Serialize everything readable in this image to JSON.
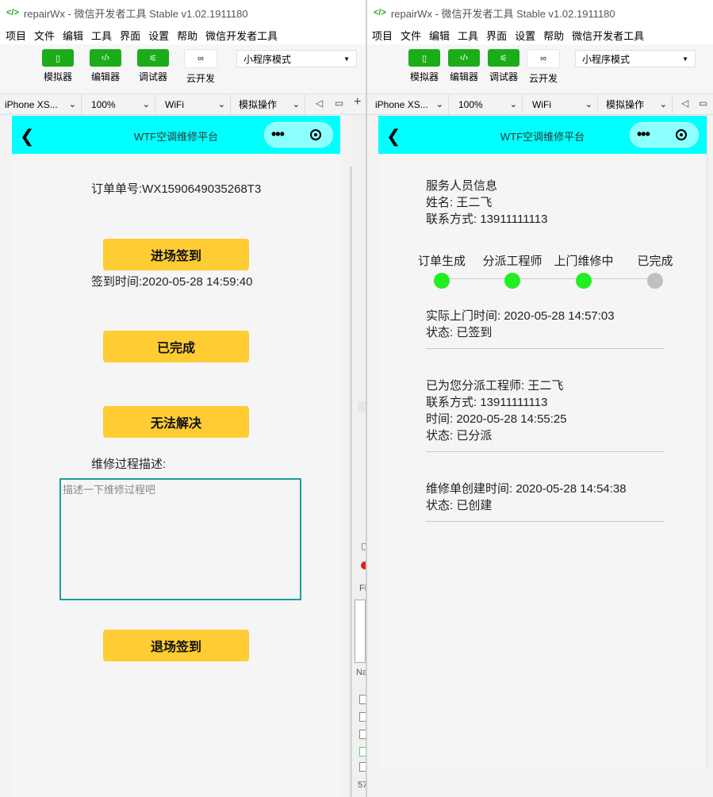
{
  "left": {
    "window_title": "repairWx - 微信开发者工具 Stable v1.02.1911180",
    "menu": [
      "项目",
      "文件",
      "编辑",
      "工具",
      "界面",
      "设置",
      "帮助",
      "微信开发者工具"
    ],
    "toolbar": [
      {
        "label": "模拟器",
        "icon": "phone-icon"
      },
      {
        "label": "编辑器",
        "icon": "code-icon"
      },
      {
        "label": "调试器",
        "icon": "debug-icon"
      },
      {
        "label": "云开发",
        "icon": "cloud-link-icon"
      }
    ],
    "mode": "小程序模式",
    "device_bar": {
      "device": "iPhone XS...",
      "zoom": "100%",
      "network": "WiFi",
      "simulate": "模拟操作"
    },
    "page": {
      "nav_title": "WTF空调维修平台",
      "order_label": "订单单号:",
      "order_no": "WX1590649035268T3",
      "checkin_button": "进场签到",
      "checkin_time_label": "签到时间:",
      "checkin_time": "2020-05-28 14:59:40",
      "done_button": "已完成",
      "unsolved_button": "无法解决",
      "desc_label": "维修过程描述:",
      "desc_placeholder": "描述一下维修过程吧",
      "checkout_button": "退场签到"
    },
    "side_panel": {
      "network_filter_label": "Fi",
      "name_col": "Na",
      "footer": "57"
    }
  },
  "right": {
    "window_title": "repairWx - 微信开发者工具 Stable v1.02.1911180",
    "menu": [
      "项目",
      "文件",
      "编辑",
      "工具",
      "界面",
      "设置",
      "帮助",
      "微信开发者工具"
    ],
    "toolbar": [
      {
        "label": "模拟器",
        "icon": "phone-icon"
      },
      {
        "label": "编辑器",
        "icon": "code-icon"
      },
      {
        "label": "调试器",
        "icon": "debug-icon"
      },
      {
        "label": "云开发",
        "icon": "cloud-link-icon"
      }
    ],
    "mode": "小程序模式",
    "device_bar": {
      "device": "iPhone XS...",
      "zoom": "100%",
      "network": "WiFi",
      "simulate": "模拟操作"
    },
    "page": {
      "nav_title": "WTF空调维修平台",
      "staff_title": "服务人员信息",
      "staff_name_line": "姓名: 王二飞",
      "staff_contact_line": "联系方式: 13911111113",
      "steps": [
        {
          "label": "订单生成",
          "color": "#22ee22"
        },
        {
          "label": "分派工程师",
          "color": "#22ee22"
        },
        {
          "label": "上门维修中",
          "color": "#22ee22"
        },
        {
          "label": "已完成",
          "color": "#c0c0c0"
        }
      ],
      "timeline": [
        {
          "line1": "实际上门时间: 2020-05-28 14:57:03",
          "line2": "状态: 已签到"
        },
        {
          "line1": "已为您分派工程师: 王二飞",
          "line2": "联系方式: 13911111113",
          "line3": "时间: 2020-05-28 14:55:25",
          "line4": "状态: 已分派"
        },
        {
          "line1": "维修单创建时间: 2020-05-28 14:54:38",
          "line2": "状态: 已创建"
        }
      ]
    }
  }
}
